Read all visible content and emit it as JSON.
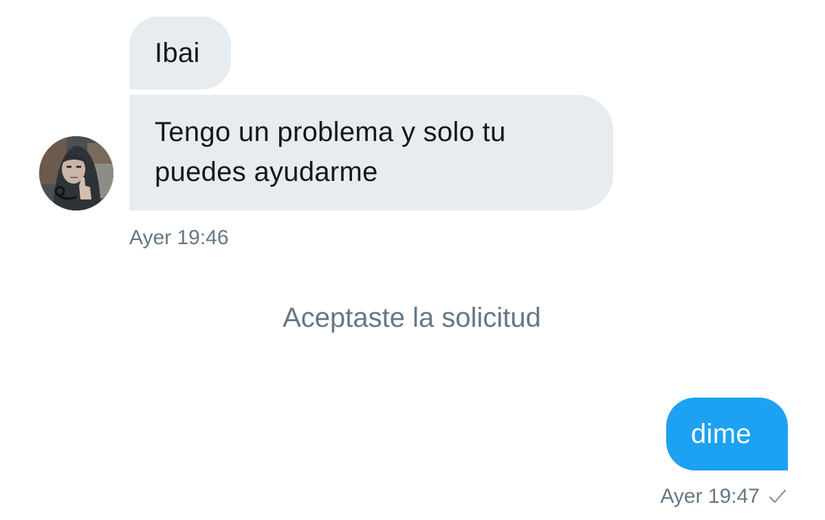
{
  "conversation": {
    "incoming": {
      "messages": [
        {
          "text": "Ibai"
        },
        {
          "text": "Tengo un problema y solo tu puedes ayudarme"
        }
      ],
      "timestamp": "Ayer 19:46",
      "avatar_icon": "user-avatar-photo"
    },
    "system_notice": "Aceptaste la solicitud",
    "outgoing": {
      "messages": [
        {
          "text": "dime"
        }
      ],
      "timestamp": "Ayer 19:47",
      "status_icon": "checkmark-icon"
    }
  },
  "colors": {
    "incoming_bubble": "#e6ecf0",
    "outgoing_bubble": "#1da1f2",
    "meta_text": "#657786"
  }
}
